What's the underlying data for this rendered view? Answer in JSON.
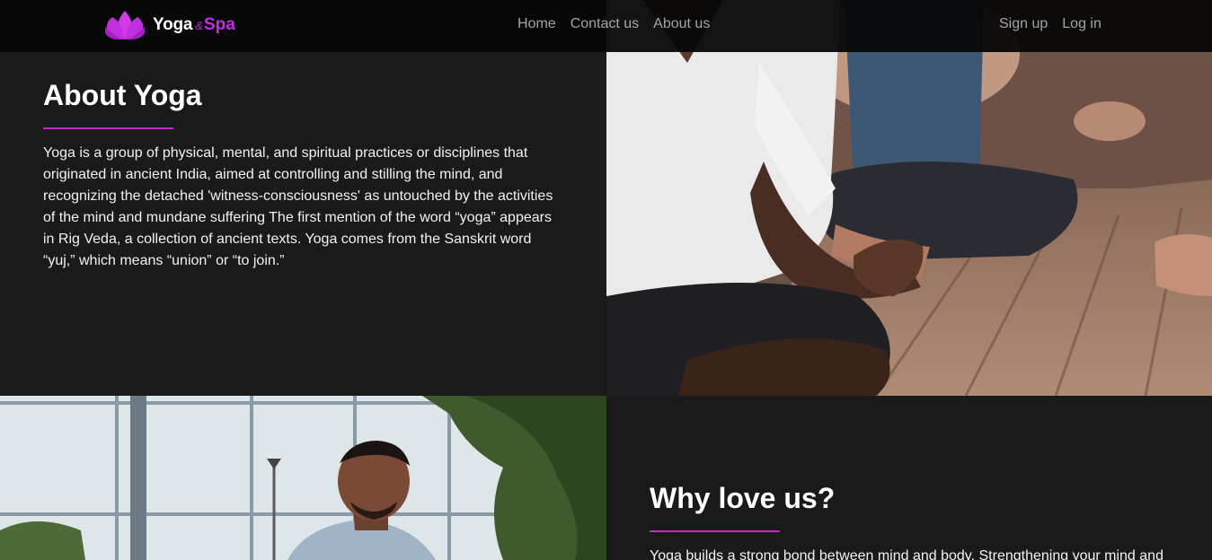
{
  "colors": {
    "accent": "#c22bbf",
    "brand_spa": "#c02fe0",
    "logo_lotus": "#d43be8",
    "nav_background": "#0a0a0a",
    "section_background": "#1a1a1b",
    "nav_link": "#a7a7a7"
  },
  "brand": {
    "logo_icon": "lotus-icon",
    "name_primary": "Yoga",
    "name_amp": "&",
    "name_secondary": "Spa"
  },
  "nav": {
    "links": [
      "Home",
      "Contact us",
      "About us"
    ],
    "auth": [
      "Sign up",
      "Log in"
    ]
  },
  "about": {
    "title": "About Yoga",
    "text": "Yoga is a group of physical, mental, and spiritual practices or disciplines that originated in ancient India, aimed at controlling and stilling the mind, and recognizing the detached 'witness-consciousness' as untouched by the activities of the mind and mundane suffering The first mention of the word “yoga” appears in Rig Veda, a collection of ancient texts. Yoga comes from the Sanskrit word “yuj,” which means “union” or “to join.”"
  },
  "why": {
    "title": "Why love us?",
    "text": "Yoga builds a strong bond between mind and body. Strengthening your mind and"
  }
}
